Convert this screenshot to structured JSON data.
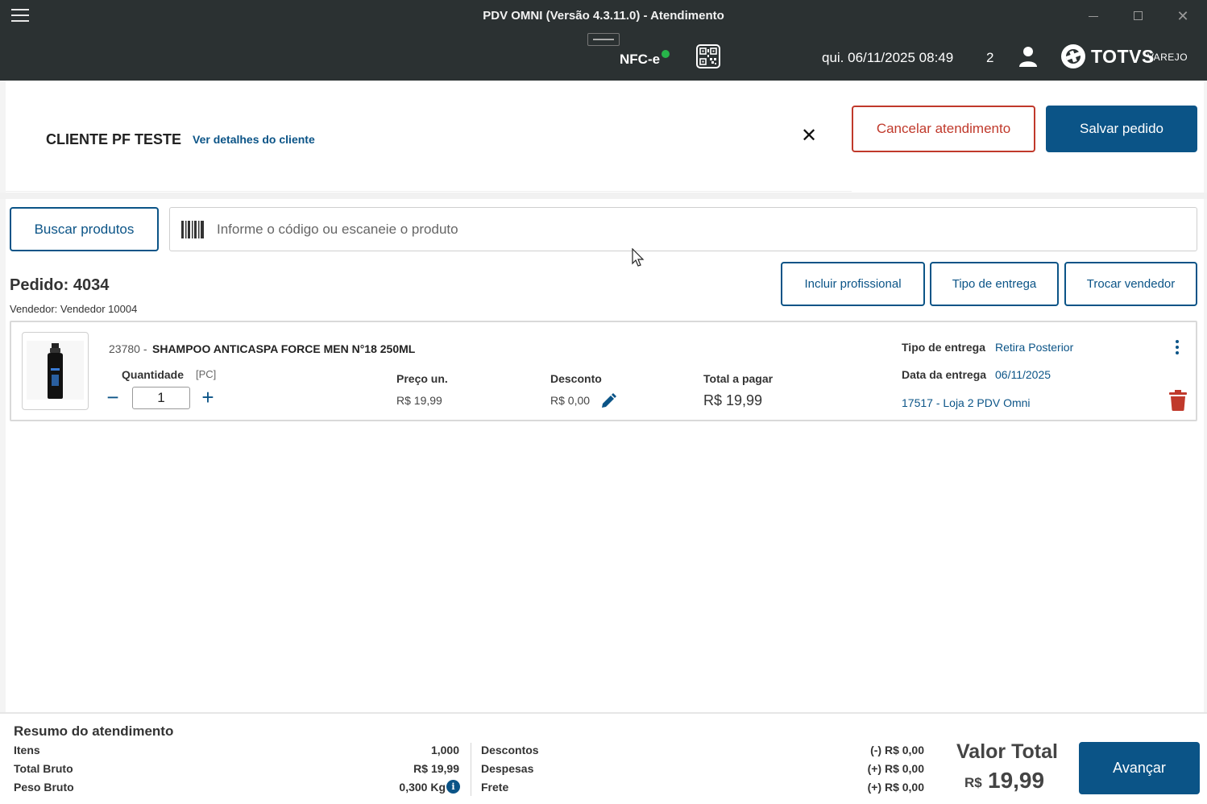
{
  "window": {
    "title": "PDV OMNI (Versão 4.3.11.0) - Atendimento",
    "close_glyph": "✕"
  },
  "header": {
    "nfce": "NFC-e",
    "datetime": "qui. 06/11/2025 08:49",
    "counter": "2",
    "brand": "TOTVS",
    "brand_sub": "VAREJO",
    "status_color": "#27b54a"
  },
  "client": {
    "name": "CLIENTE PF TESTE",
    "details_link": "Ver detalhes do cliente",
    "close_glyph": "✕"
  },
  "actions": {
    "cancel": "Cancelar atendimento",
    "save": "Salvar pedido"
  },
  "search": {
    "button": "Buscar produtos",
    "placeholder": "Informe o código ou escaneie o produto"
  },
  "order": {
    "title": "Pedido: 4034",
    "seller": "Vendedor: Vendedor 10004",
    "buttons": {
      "professional": "Incluir profissional",
      "delivery_type": "Tipo de entrega",
      "change_seller": "Trocar vendedor"
    }
  },
  "item": {
    "code": "23780 -",
    "name": "SHAMPOO ANTICASPA FORCE MEN N°18 250ML",
    "quantity_label": "Quantidade",
    "unit": "[PC]",
    "minus": "−",
    "plus": "+",
    "quantity": "1",
    "price_label": "Preço un.",
    "price": "R$ 19,99",
    "discount_label": "Desconto",
    "discount": "R$ 0,00",
    "total_label": "Total a pagar",
    "total": "R$ 19,99",
    "delivery_type_label": "Tipo de entrega",
    "delivery_type": "Retira Posterior",
    "delivery_date_label": "Data da entrega",
    "delivery_date": "06/11/2025",
    "store": "17517 - Loja 2 PDV Omni"
  },
  "summary": {
    "title": "Resumo do atendimento",
    "items_label": "Itens",
    "items": "1,000",
    "gross_total_label": "Total Bruto",
    "gross_total": "R$ 19,99",
    "gross_weight_label": "Peso Bruto",
    "gross_weight": "0,300 Kg",
    "info_glyph": "i",
    "discounts_label": "Descontos",
    "discounts": "(-) R$ 0,00",
    "expenses_label": "Despesas",
    "expenses": "(+) R$ 0,00",
    "freight_label": "Frete",
    "freight": "(+) R$ 0,00",
    "total_label": "Valor Total",
    "currency": "R$",
    "total": "19,99",
    "advance": "Avançar"
  },
  "colors": {
    "primary": "#0b5487",
    "danger": "#c0392b",
    "titlebar": "#2b3132"
  }
}
